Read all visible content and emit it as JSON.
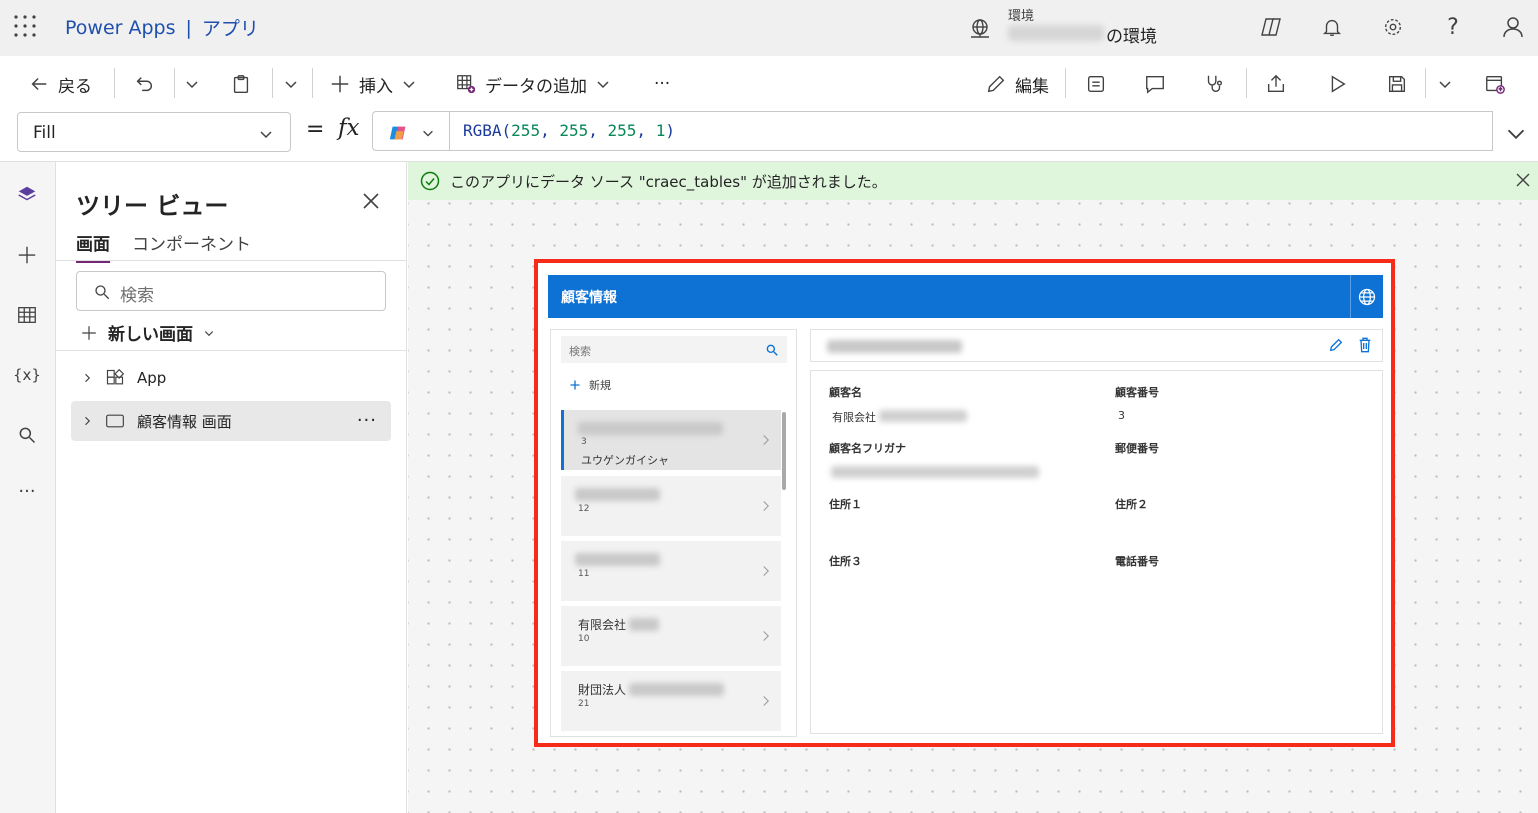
{
  "header": {
    "app_name": "Power Apps",
    "separator": "|",
    "section": "アプリ",
    "environment_label": "環境",
    "environment_suffix": "の環境"
  },
  "commands": {
    "back": "戻る",
    "insert": "挿入",
    "add_data": "データの追加",
    "more": "···",
    "edit": "編集"
  },
  "formula_bar": {
    "property": "Fill",
    "equals": "=",
    "fx": "fx",
    "formula_prefix": "RGBA(",
    "formula_args": [
      "255",
      "255",
      "255",
      "1"
    ],
    "formula_suffix": ")"
  },
  "tree_view": {
    "title": "ツリー ビュー",
    "tabs": [
      "画面",
      "コンポーネント"
    ],
    "search_placeholder": "検索",
    "new_screen": "新しい画面",
    "nodes": [
      {
        "label": "App"
      },
      {
        "label": "顧客情報 画面",
        "more": "···"
      }
    ]
  },
  "notification": {
    "message": "このアプリにデータ ソース \"craec_tables\" が追加されました。"
  },
  "preview": {
    "header_title": "顧客情報",
    "list_search_placeholder": "検索",
    "new_label": "新規",
    "items": [
      {
        "number": "3",
        "kana": "ユウゲンガイシャ"
      },
      {
        "number": "12"
      },
      {
        "number": "11"
      },
      {
        "prefix": "有限会社",
        "number": "10"
      },
      {
        "prefix": "財団法人",
        "number": "21"
      }
    ],
    "fields": {
      "customer_name": "顧客名",
      "customer_name_value_prefix": "有限会社",
      "customer_number": "顧客番号",
      "customer_number_value": "3",
      "customer_kana": "顧客名フリガナ",
      "postal_code": "郵便番号",
      "address1": "住所１",
      "address2": "住所２",
      "address3": "住所３",
      "phone": "電話番号"
    }
  },
  "colors": {
    "brand": "#1f4fae",
    "app_header": "#0e72d4",
    "highlight": "#f62b1a",
    "toast_bg": "#dff6dd",
    "accent_tab": "#742774"
  }
}
